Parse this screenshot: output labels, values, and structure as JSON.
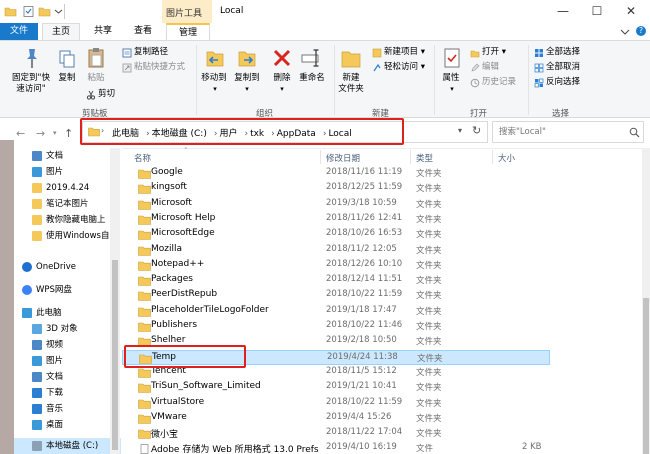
{
  "titlebar": {
    "context_tab": "图片工具",
    "title": "Local",
    "minimize": "—",
    "maximize": "☐",
    "close": "✕"
  },
  "tabs": {
    "file": "文件",
    "home": "主页",
    "share": "共享",
    "view": "查看",
    "manage": "管理"
  },
  "ribbon": {
    "clipboard": {
      "pin_line1": "固定到\"快",
      "pin_line2": "速访问\"",
      "copy": "复制",
      "paste": "粘贴",
      "copy_path": "复制路径",
      "paste_shortcut": "粘贴快捷方式",
      "cut": "剪切",
      "group": "剪贴板"
    },
    "organize": {
      "move_to": "移动到",
      "copy_to": "复制到",
      "delete": "删除",
      "rename": "重命名",
      "group": "组织"
    },
    "new": {
      "new_folder_line1": "新建",
      "new_folder_line2": "文件夹",
      "new_item": "新建项目",
      "easy_access": "轻松访问",
      "group": "新建"
    },
    "open": {
      "properties": "属性",
      "open": "打开",
      "edit": "编辑",
      "history": "历史记录",
      "group": "打开"
    },
    "select": {
      "select_all": "全部选择",
      "select_none": "全部取消",
      "invert": "反向选择",
      "group": "选择"
    }
  },
  "address": {
    "crumbs": [
      "此电脑",
      "本地磁盘 (C:)",
      "用户",
      "txk",
      "AppData",
      "Local"
    ],
    "search_placeholder": "搜索\"Local\""
  },
  "nav": {
    "items": [
      {
        "label": "文档",
        "icon": "documents-icon"
      },
      {
        "label": "图片",
        "icon": "pictures-icon"
      },
      {
        "label": "2019.4.24",
        "icon": "folder-icon"
      },
      {
        "label": "笔记本图片",
        "icon": "folder-icon"
      },
      {
        "label": "教你隐藏电脑上",
        "icon": "folder-icon"
      },
      {
        "label": "使用Windows自",
        "icon": "folder-icon"
      },
      {
        "label": "OneDrive",
        "icon": "onedrive-icon"
      },
      {
        "label": "WPS网盘",
        "icon": "wps-cloud-icon"
      },
      {
        "label": "此电脑",
        "icon": "this-pc-icon"
      },
      {
        "label": "3D 对象",
        "icon": "3d-objects-icon"
      },
      {
        "label": "视频",
        "icon": "videos-icon"
      },
      {
        "label": "图片",
        "icon": "pictures-icon"
      },
      {
        "label": "文档",
        "icon": "documents-icon"
      },
      {
        "label": "下载",
        "icon": "downloads-icon"
      },
      {
        "label": "音乐",
        "icon": "music-icon"
      },
      {
        "label": "桌面",
        "icon": "desktop-icon"
      },
      {
        "label": "本地磁盘 (C:)",
        "icon": "drive-icon"
      }
    ]
  },
  "columns": {
    "name": "名称",
    "date": "修改日期",
    "type": "类型",
    "size": "大小"
  },
  "files": [
    {
      "name": "Google",
      "date": "2018/11/16 11:19",
      "type": "文件夹",
      "size": ""
    },
    {
      "name": "kingsoft",
      "date": "2018/12/25 11:59",
      "type": "文件夹",
      "size": ""
    },
    {
      "name": "Microsoft",
      "date": "2019/3/18 10:59",
      "type": "文件夹",
      "size": ""
    },
    {
      "name": "Microsoft Help",
      "date": "2018/11/26 12:41",
      "type": "文件夹",
      "size": ""
    },
    {
      "name": "MicrosoftEdge",
      "date": "2018/10/26 16:53",
      "type": "文件夹",
      "size": ""
    },
    {
      "name": "Mozilla",
      "date": "2018/11/2 12:05",
      "type": "文件夹",
      "size": ""
    },
    {
      "name": "Notepad++",
      "date": "2018/12/26 10:10",
      "type": "文件夹",
      "size": ""
    },
    {
      "name": "Packages",
      "date": "2018/12/14 11:51",
      "type": "文件夹",
      "size": ""
    },
    {
      "name": "PeerDistRepub",
      "date": "2018/10/22 11:59",
      "type": "文件夹",
      "size": ""
    },
    {
      "name": "PlaceholderTileLogoFolder",
      "date": "2019/1/18 17:47",
      "type": "文件夹",
      "size": ""
    },
    {
      "name": "Publishers",
      "date": "2018/10/22 11:46",
      "type": "文件夹",
      "size": ""
    },
    {
      "name": "Shelher",
      "date": "2019/2/18 10:50",
      "type": "文件夹",
      "size": ""
    },
    {
      "name": "Temp",
      "date": "2019/4/24 11:38",
      "type": "文件夹",
      "size": ""
    },
    {
      "name": "Tencent",
      "date": "2018/11/5 15:12",
      "type": "文件夹",
      "size": ""
    },
    {
      "name": "TriSun_Software_Limited",
      "date": "2019/1/21 10:41",
      "type": "文件夹",
      "size": ""
    },
    {
      "name": "VirtualStore",
      "date": "2018/10/22 11:59",
      "type": "文件夹",
      "size": ""
    },
    {
      "name": "VMware",
      "date": "2019/4/4 15:26",
      "type": "文件夹",
      "size": ""
    },
    {
      "name": "微小宝",
      "date": "2018/11/22 17:04",
      "type": "文件夹",
      "size": ""
    },
    {
      "name": "Adobe 存储为 Web 所用格式 13.0 Prefs",
      "date": "2019/4/10 16:19",
      "type": "文件",
      "size": "2 KB"
    }
  ],
  "selected_file": "Temp",
  "colors": {
    "accent": "#1979ca",
    "highlight": "#e0201c",
    "selection": "#cce8ff",
    "folder": "#f5c85a"
  }
}
